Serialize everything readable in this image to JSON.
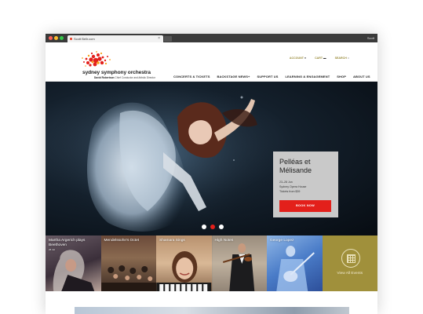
{
  "browser": {
    "tab_title": "Scott Bellr.com",
    "user": "Scott"
  },
  "header": {
    "logo_title": "sydney symphony orchestra",
    "logo_sub_name": "David Robertson",
    "logo_sub_role": "Chief Conductor and Artistic Director",
    "utility": [
      "ACCOUNT",
      "CART",
      "SEARCH"
    ],
    "nav": [
      "CONCERTS & TICKETS",
      "BACKSTAGE NEWS+",
      "SUPPORT US",
      "LEARNING & ENGAGEMENT",
      "SHOP",
      "ABOUT US"
    ]
  },
  "hero": {
    "title": "Pelléas et Mélisande",
    "dates": "23–28 Jun",
    "venue": "Sydney Opera House",
    "price": "Tickets from $39",
    "button": "BOOK NOW",
    "slides": 3,
    "active_slide": 2
  },
  "tiles": [
    {
      "title": "Martha Argerich plays Beethoven",
      "date": "26 Jul"
    },
    {
      "title": "Mendelssohn's Octet",
      "date": ""
    },
    {
      "title": "Shamara Sings",
      "date": ""
    },
    {
      "title": "High Notes",
      "date": ""
    },
    {
      "title": "George Lopez",
      "date": ""
    }
  ],
  "view_all": "View All Events",
  "colors": {
    "accent_red": "#e3201b",
    "gold": "#a0903b",
    "nav_gold": "#9a8b3a"
  }
}
